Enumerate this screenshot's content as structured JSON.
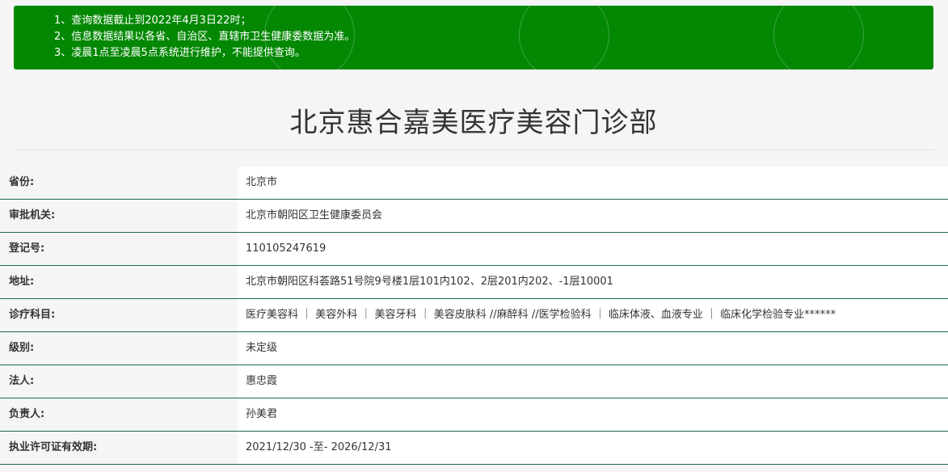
{
  "notice": {
    "lines": [
      "1、查询数据截止到2022年4月3日22时；",
      "2、信息数据结果以各省、自治区、直辖市卫生健康委数据为准。",
      "3、凌晨1点至凌晨5点系统进行维护，不能提供查询。"
    ],
    "background": "#048804"
  },
  "page": {
    "title": "北京惠合嘉美医疗美容门诊部"
  },
  "info": {
    "rows": [
      {
        "label": "省份:",
        "value": "北京市"
      },
      {
        "label": "审批机关:",
        "value": "北京市朝阳区卫生健康委员会"
      },
      {
        "label": "登记号:",
        "value": "110105247619"
      },
      {
        "label": "地址:",
        "value": "北京市朝阳区科荟路51号院9号楼1层101内102、2层201内202、-1层10001"
      },
      {
        "label": "诊疗科目:",
        "value": "医疗美容科 ｜ 美容外科 ｜ 美容牙科 ｜ 美容皮肤科 //麻醉科 //医学检验科 ｜ 临床体液、血液专业 ｜ 临床化学检验专业******"
      },
      {
        "label": "级别:",
        "value": "未定级"
      },
      {
        "label": "法人:",
        "value": "惠忠霞"
      },
      {
        "label": "负责人:",
        "value": "孙美君"
      },
      {
        "label": "执业许可证有效期:",
        "value": "2021/12/30 -至- 2026/12/31"
      }
    ],
    "border_color": "#1d6b45"
  }
}
